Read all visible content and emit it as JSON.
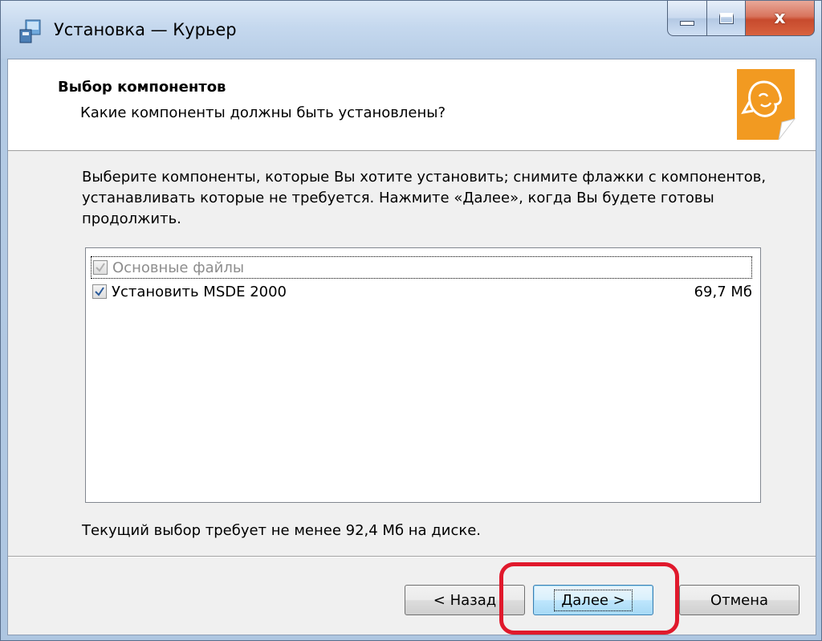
{
  "window": {
    "title": "Установка — Курьер",
    "controls": {
      "minimize": "",
      "maximize": "",
      "close": "x"
    }
  },
  "header": {
    "title": "Выбор компонентов",
    "subtitle": "Какие компоненты должны быть установлены?"
  },
  "description": "Выберите компоненты, которые Вы хотите установить; снимите флажки с компонентов, устанавливать которые не требуется. Нажмите «Далее», когда Вы будете готовы продолжить.",
  "components": [
    {
      "label": "Основные файлы",
      "size": "",
      "checked": true,
      "disabled": true
    },
    {
      "label": "Установить MSDE 2000",
      "size": "69,7 Мб",
      "checked": true,
      "disabled": false
    }
  ],
  "disk_info": "Текущий выбор требует не менее 92,4 Мб на диске.",
  "buttons": {
    "back": "< Назад",
    "next": "Далее >",
    "cancel": "Отмена"
  },
  "colors": {
    "highlight": "#e0192c",
    "logo": "#f29a21"
  }
}
